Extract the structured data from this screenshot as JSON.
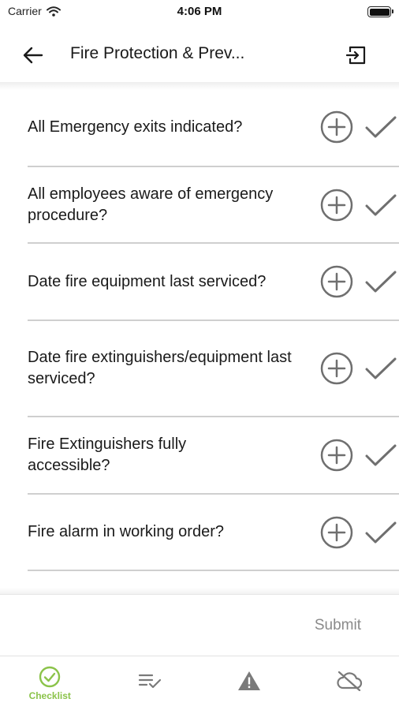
{
  "status_bar": {
    "carrier": "Carrier",
    "time": "4:06 PM"
  },
  "header": {
    "title": "Fire Protection & Prev..."
  },
  "checklist_items": [
    {
      "label": "All Emergency exits indicated?"
    },
    {
      "label": "All employees aware of emergency procedure?"
    },
    {
      "label": "Date fire equipment last serviced?"
    },
    {
      "label": "Date fire extinguishers/equipment last serviced?"
    },
    {
      "label": "Fire Extinguishers fully accessible?"
    },
    {
      "label": "Fire alarm in working order?"
    }
  ],
  "submit": {
    "label": "Submit"
  },
  "tabs": [
    {
      "label": "Checklist",
      "icon": "check-circle-icon",
      "active": true
    },
    {
      "label": "",
      "icon": "list-check-icon",
      "active": false
    },
    {
      "label": "",
      "icon": "warning-icon",
      "active": false
    },
    {
      "label": "",
      "icon": "cloud-off-icon",
      "active": false
    }
  ],
  "colors": {
    "accent": "#8bc34a",
    "icon_gray": "#6f6f6f",
    "divider": "#cfcfcf"
  }
}
